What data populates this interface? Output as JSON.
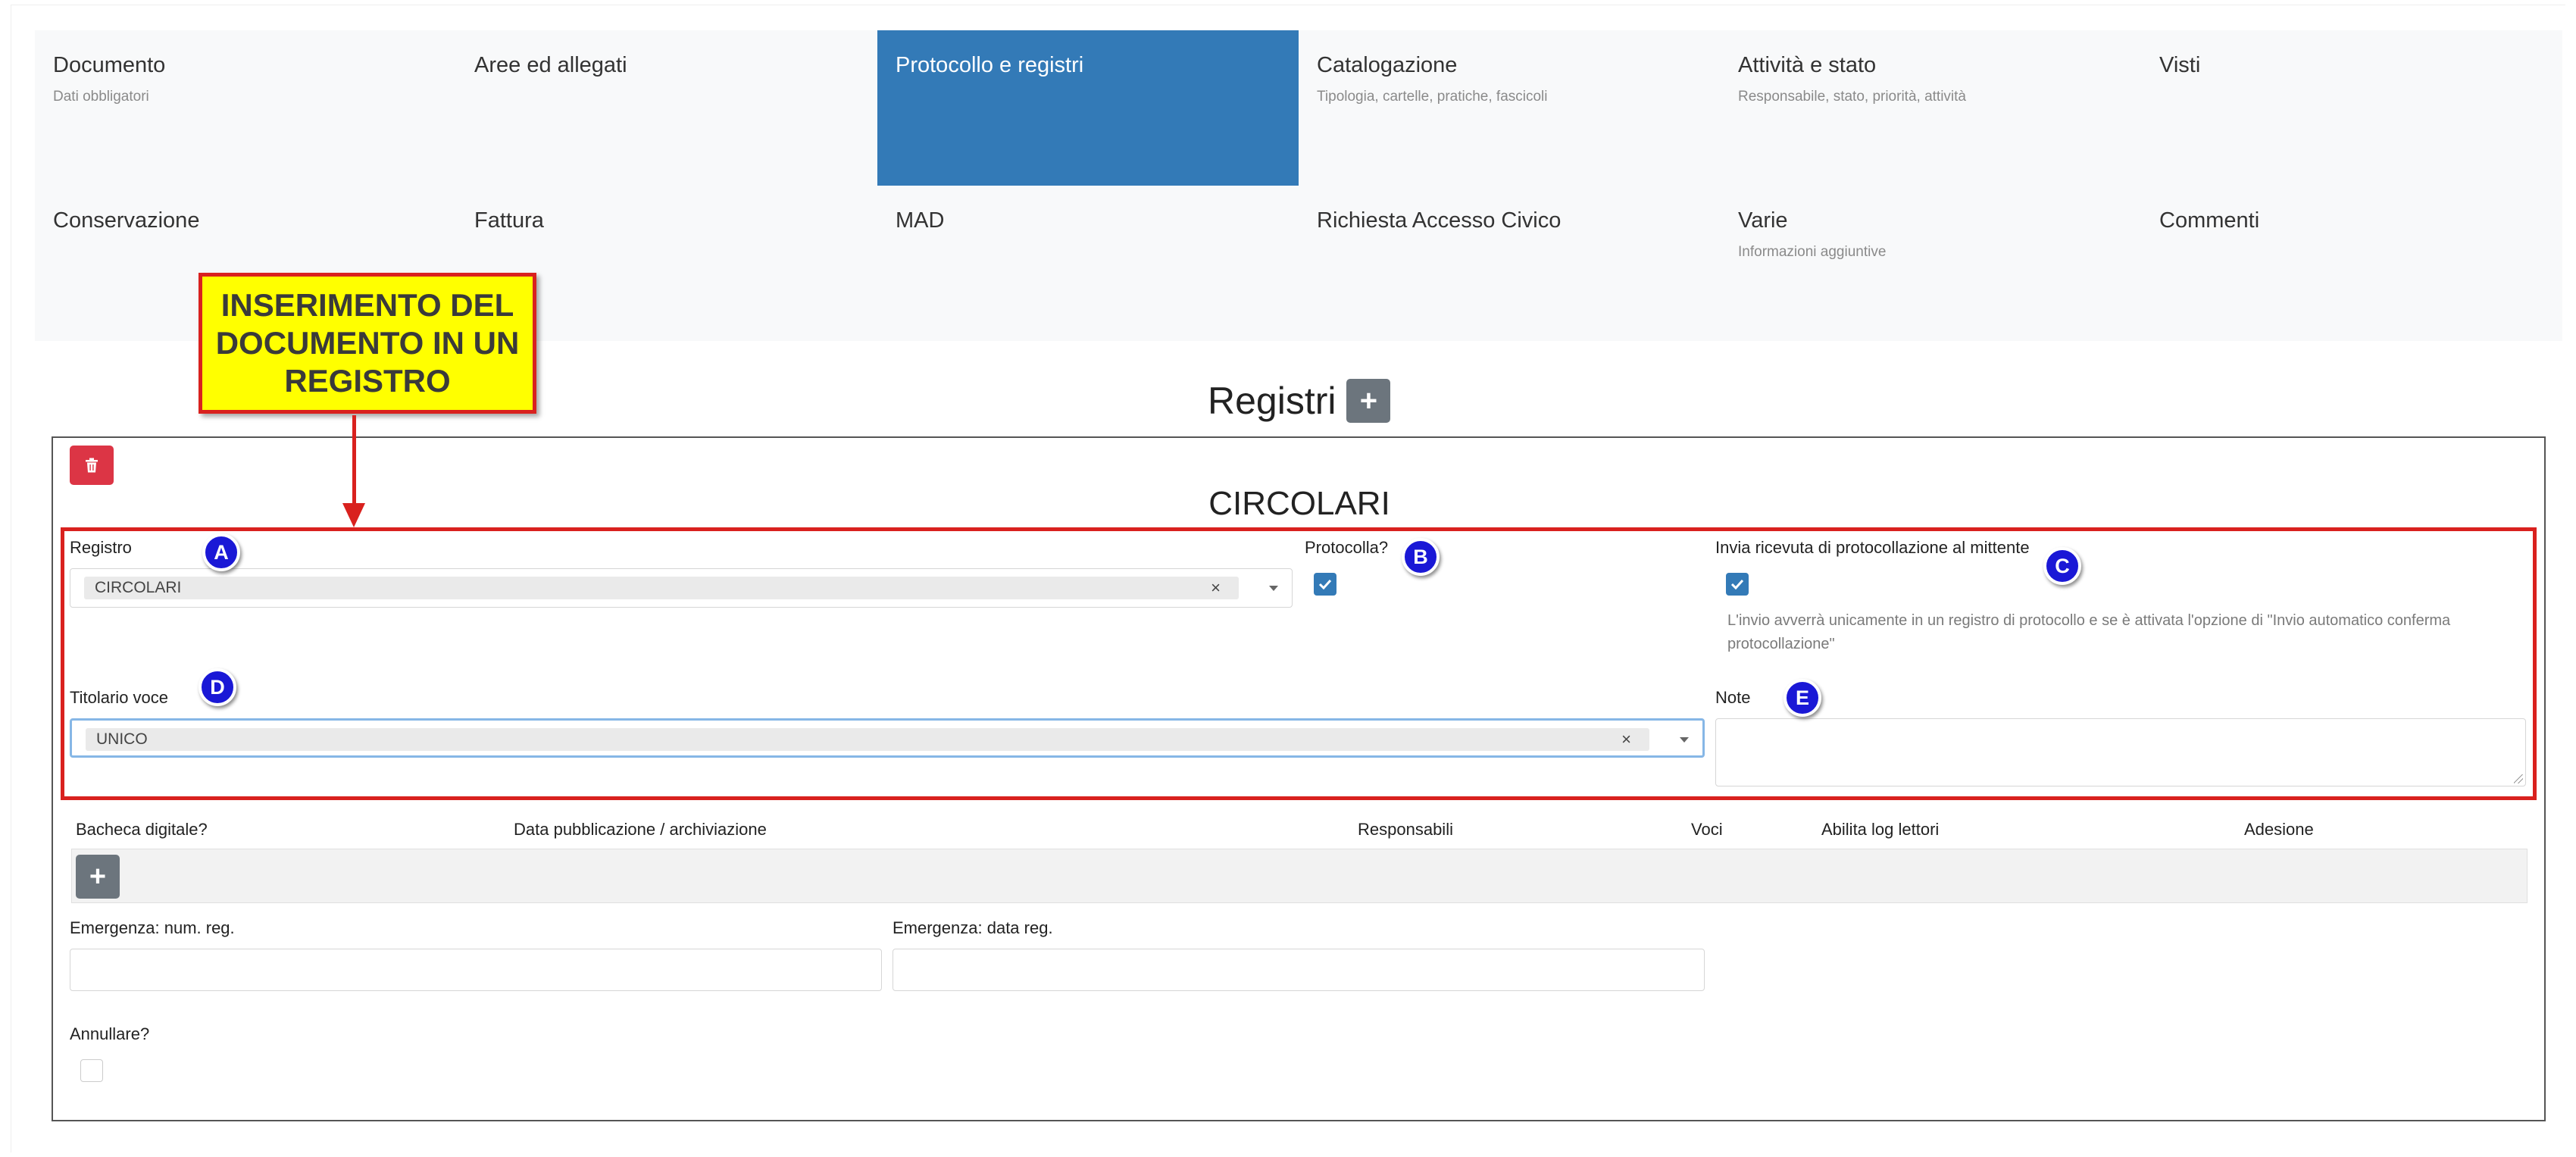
{
  "tabs": [
    {
      "title": "Documento",
      "subtitle": "Dati obbligatori"
    },
    {
      "title": "Aree ed allegati",
      "subtitle": ""
    },
    {
      "title": "Protocollo e registri",
      "subtitle": ""
    },
    {
      "title": "Catalogazione",
      "subtitle": "Tipologia, cartelle, pratiche, fascicoli"
    },
    {
      "title": "Attività e stato",
      "subtitle": "Responsabile, stato, priorità, attività"
    },
    {
      "title": "Visti",
      "subtitle": ""
    },
    {
      "title": "Conservazione",
      "subtitle": ""
    },
    {
      "title": "Fattura",
      "subtitle": ""
    },
    {
      "title": "MAD",
      "subtitle": ""
    },
    {
      "title": "Richiesta Accesso Civico",
      "subtitle": ""
    },
    {
      "title": "Varie",
      "subtitle": "Informazioni aggiuntive"
    },
    {
      "title": "Commenti",
      "subtitle": ""
    }
  ],
  "active_tab": "Protocollo e registri",
  "callout": {
    "text": "INSERIMENTO DEL DOCUMENTO IN UN REGISTRO"
  },
  "section": {
    "title": "Registri",
    "add_symbol": "+"
  },
  "panel": {
    "title": "CIRCOLARI",
    "registro": {
      "label": "Registro",
      "value": "CIRCOLARI",
      "clear": "×"
    },
    "protocolla": {
      "label": "Protocolla?",
      "checked": true
    },
    "invia_ricevuta": {
      "label": "Invia ricevuta di protocollazione al mittente",
      "checked": true,
      "help": "L'invio avverrà unicamente in un registro di protocollo e se è attivata l'opzione di \"Invio automatico conferma protocollazione\""
    },
    "titolario": {
      "label": "Titolario voce",
      "value": "UNICO",
      "clear": "×"
    },
    "note": {
      "label": "Note",
      "value": ""
    },
    "table_headers": [
      "Bacheca digitale?",
      "Data pubblicazione / archiviazione",
      "Responsabili",
      "Voci",
      "Abilita log lettori",
      "Adesione"
    ],
    "table_add_symbol": "+",
    "emergenza_num": {
      "label": "Emergenza: num. reg.",
      "value": ""
    },
    "emergenza_data": {
      "label": "Emergenza: data reg.",
      "value": ""
    },
    "annullare": {
      "label": "Annullare?",
      "checked": false
    }
  },
  "badges": [
    "A",
    "B",
    "C",
    "D",
    "E"
  ],
  "colors": {
    "active_tab": "#337ab7",
    "delete": "#dc3545",
    "callout_bg": "#ffff00",
    "callout_border": "#d9211e",
    "badge": "#1a18d6"
  }
}
